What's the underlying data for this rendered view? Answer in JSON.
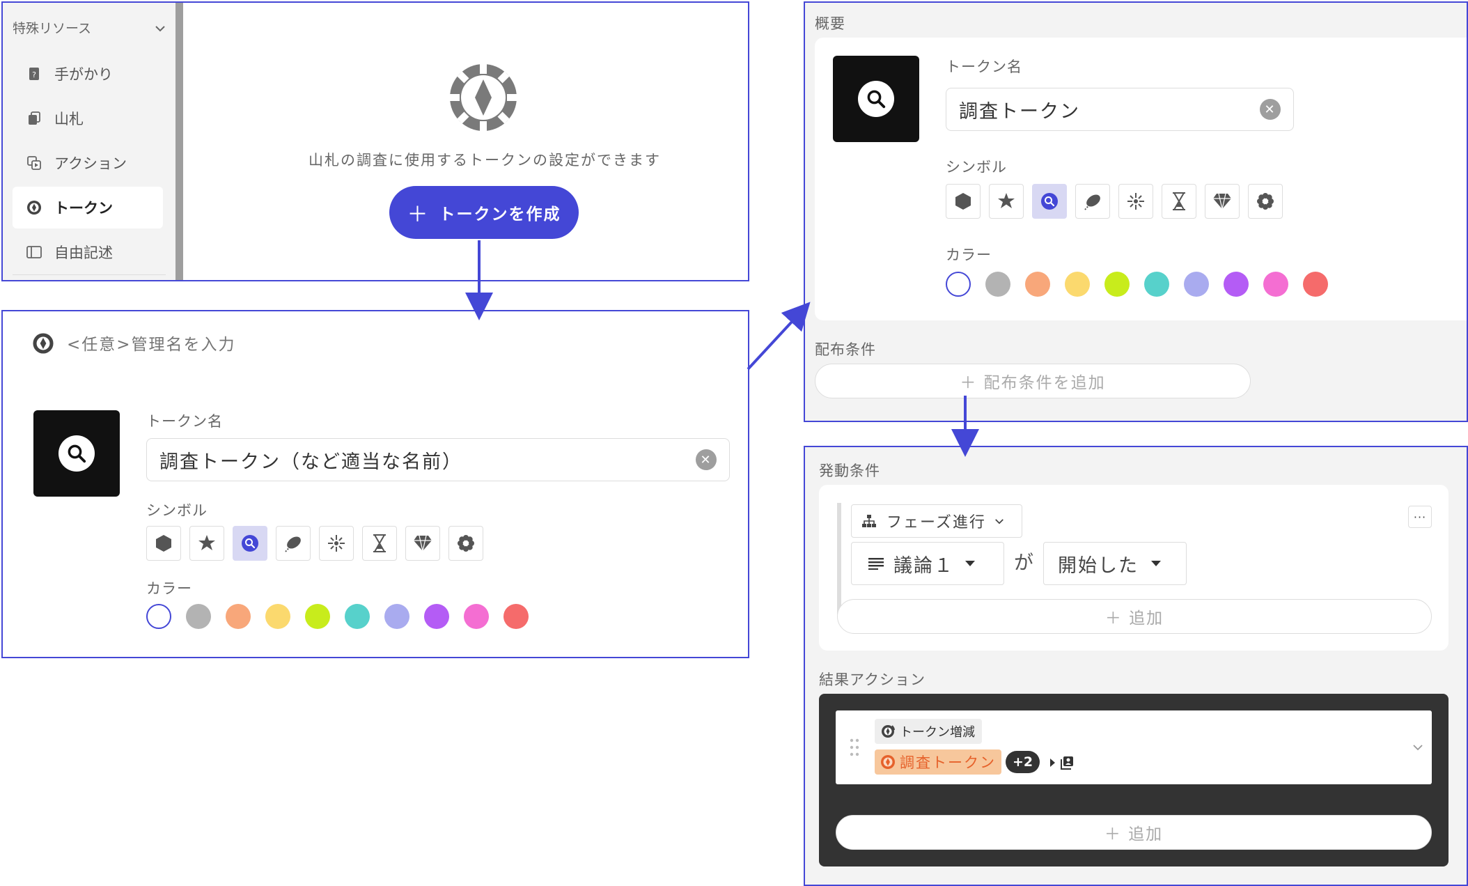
{
  "colors": {
    "accent": "#4447d6",
    "swatches": [
      "#ffffff",
      "#b3b3b3",
      "#f8a77a",
      "#fbd96e",
      "#c8ec1c",
      "#57d1cb",
      "#a9abef",
      "#b45cf5",
      "#f46ed2",
      "#f56b6b"
    ]
  },
  "sidebar": {
    "section_title": "特殊リソース",
    "items": [
      {
        "label": "手がかり",
        "icon": "clue-card-icon"
      },
      {
        "label": "山札",
        "icon": "deck-icon"
      },
      {
        "label": "アクション",
        "icon": "action-icon"
      },
      {
        "label": "トークン",
        "icon": "token-icon",
        "active": true
      },
      {
        "label": "自由記述",
        "icon": "free-text-icon"
      }
    ]
  },
  "empty_state": {
    "description": "山札の調査に使用するトークンの設定ができます",
    "create_button": "トークンを作成"
  },
  "token_form": {
    "admin_name_placeholder": "<任意>管理名を入力",
    "name_label": "トークン名",
    "name_value": "調査トークン（など適当な名前）",
    "symbol_label": "シンボル",
    "symbols": [
      "hexagon-icon",
      "star-icon",
      "magnifier-icon",
      "feather-icon",
      "sparkle-icon",
      "hourglass-icon",
      "diamond-icon",
      "gear-flower-icon"
    ],
    "selected_symbol": 2,
    "color_label": "カラー",
    "selected_color": 0
  },
  "overview": {
    "section_title": "概要",
    "name_label": "トークン名",
    "name_value": "調査トークン",
    "symbol_label": "シンボル",
    "color_label": "カラー",
    "distribution_title": "配布条件",
    "add_distribution": "＋ 配布条件を追加"
  },
  "trigger": {
    "section_title": "発動条件",
    "phase_chip": "フェーズ進行",
    "discussion_select": "議論１",
    "connector": "が",
    "state_select": "開始した",
    "add_label": "＋ 追加",
    "more_label": "···"
  },
  "result": {
    "section_title": "結果アクション",
    "action_type": "トークン増減",
    "token_name": "調査トークン",
    "amount": "+2",
    "add_label": "＋ 追加"
  }
}
